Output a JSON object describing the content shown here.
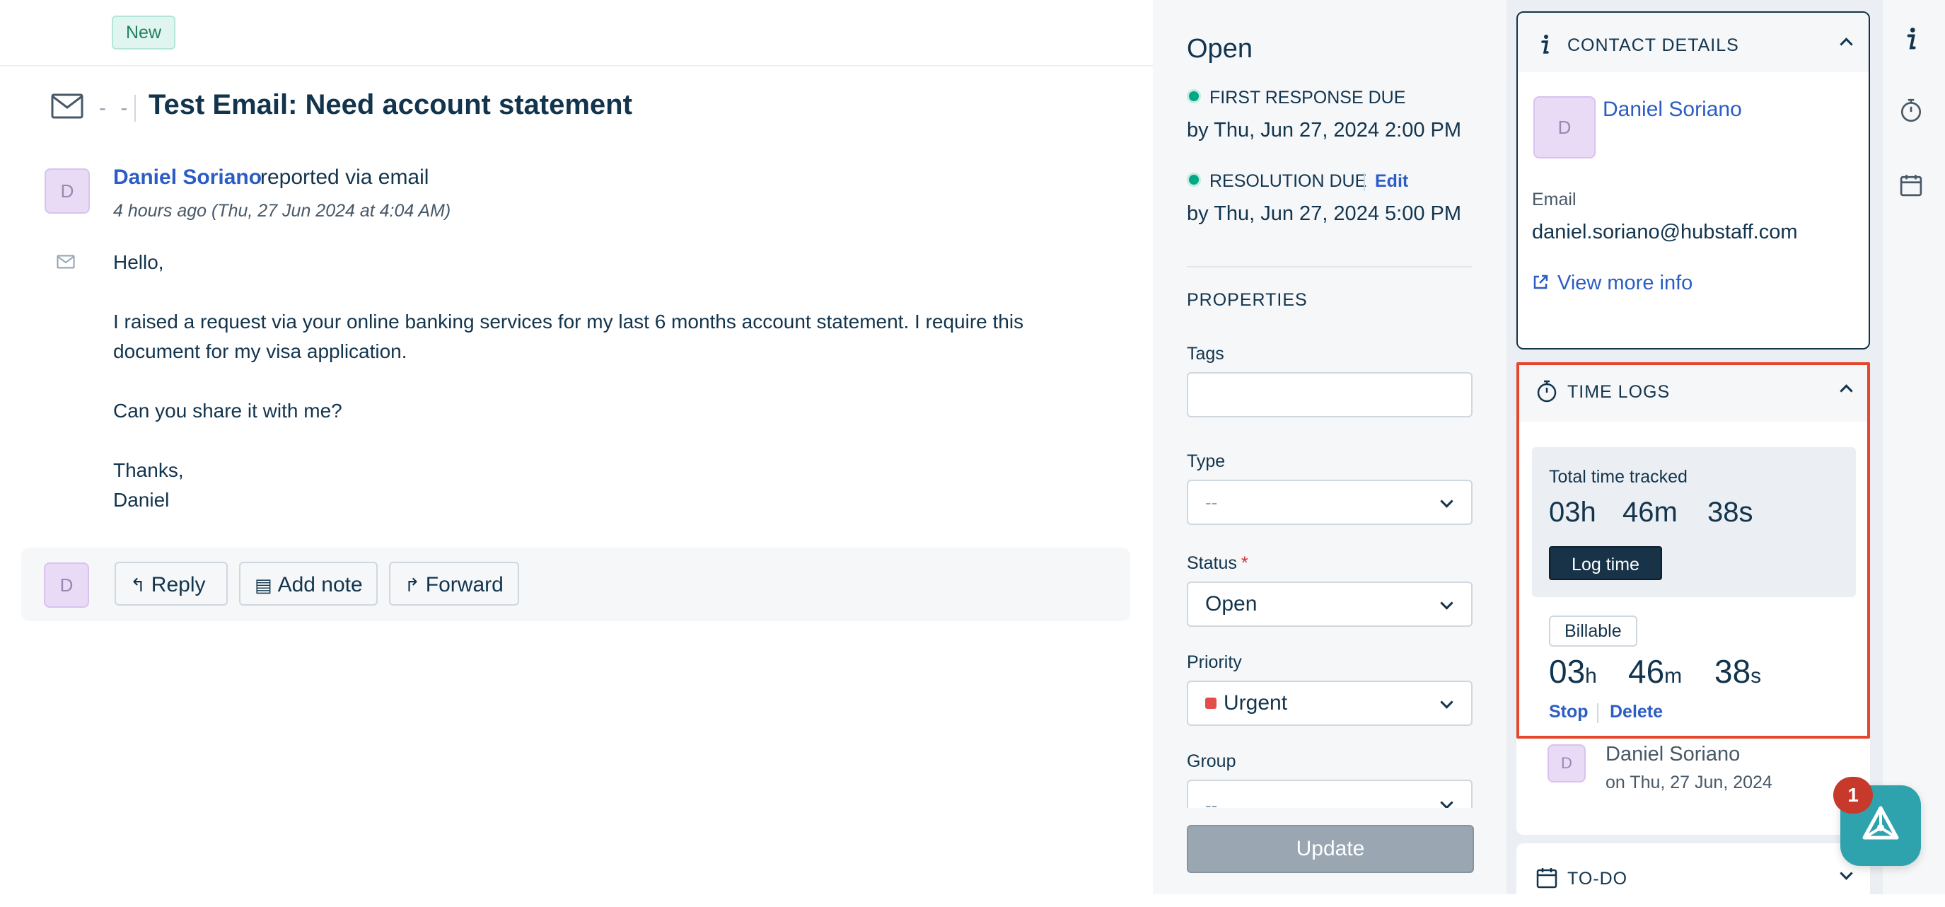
{
  "ticket": {
    "badge": "New",
    "subject_prefix": "- -",
    "subject": "Test Email: Need account statement"
  },
  "message": {
    "avatar_initial": "D",
    "sender": "Daniel Soriano",
    "via": "reported via email",
    "time_ago": "4 hours ago (Thu, 27 Jun 2024 at 4:04 AM)",
    "body": [
      "Hello,",
      "I raised a request via your online banking services for my last 6 months account statement. I require this",
      "document for my visa application.",
      "Can you share it with me?",
      "Thanks,",
      "Daniel"
    ]
  },
  "actions": {
    "avatar_initial": "D",
    "reply": "Reply",
    "add_note": "Add note",
    "forward": "Forward"
  },
  "sla": {
    "status": "Open",
    "first_response_label": "FIRST RESPONSE DUE",
    "first_response_value": "by Thu, Jun 27, 2024 2:00 PM",
    "resolution_label": "RESOLUTION DUE",
    "resolution_value": "by Thu, Jun 27, 2024 5:00 PM",
    "edit": "Edit",
    "status_color": "#00a886"
  },
  "properties": {
    "heading": "PROPERTIES",
    "tags_label": "Tags",
    "tags_value": "",
    "type_label": "Type",
    "type_value": "--",
    "status_label": "Status",
    "required_mark": "*",
    "status_value": "Open",
    "priority_label": "Priority",
    "priority_value": "Urgent",
    "priority_color": "#e24c4c",
    "group_label": "Group",
    "group_value": "--",
    "update": "Update"
  },
  "contact": {
    "title": "CONTACT DETAILS",
    "avatar_initial": "D",
    "name": "Daniel Soriano",
    "email_label": "Email",
    "email": "daniel.soriano@hubstaff.com",
    "view_more": "View more info"
  },
  "time_logs": {
    "title": "TIME LOGS",
    "total_label": "Total time tracked",
    "total_h": "03h",
    "total_m": "46m",
    "total_s": "38s",
    "log_time": "Log time",
    "billable": "Billable",
    "run_h": "03",
    "run_h_unit": "h",
    "run_m": "46",
    "run_m_unit": "m",
    "run_s": "38",
    "run_s_unit": "s",
    "stop": "Stop",
    "delete": "Delete",
    "entry_avatar": "D",
    "entry_user": "Daniel Soriano",
    "entry_date": "on Thu, 27 Jun, 2024",
    "highlight_color": "#e5472d"
  },
  "todo": {
    "title": "TO-DO"
  },
  "launcher": {
    "notification_count": "1"
  },
  "icons": {
    "subject": "envelope-icon",
    "info": "info-icon",
    "timer": "stopwatch-icon",
    "calendar": "calendar-icon"
  }
}
